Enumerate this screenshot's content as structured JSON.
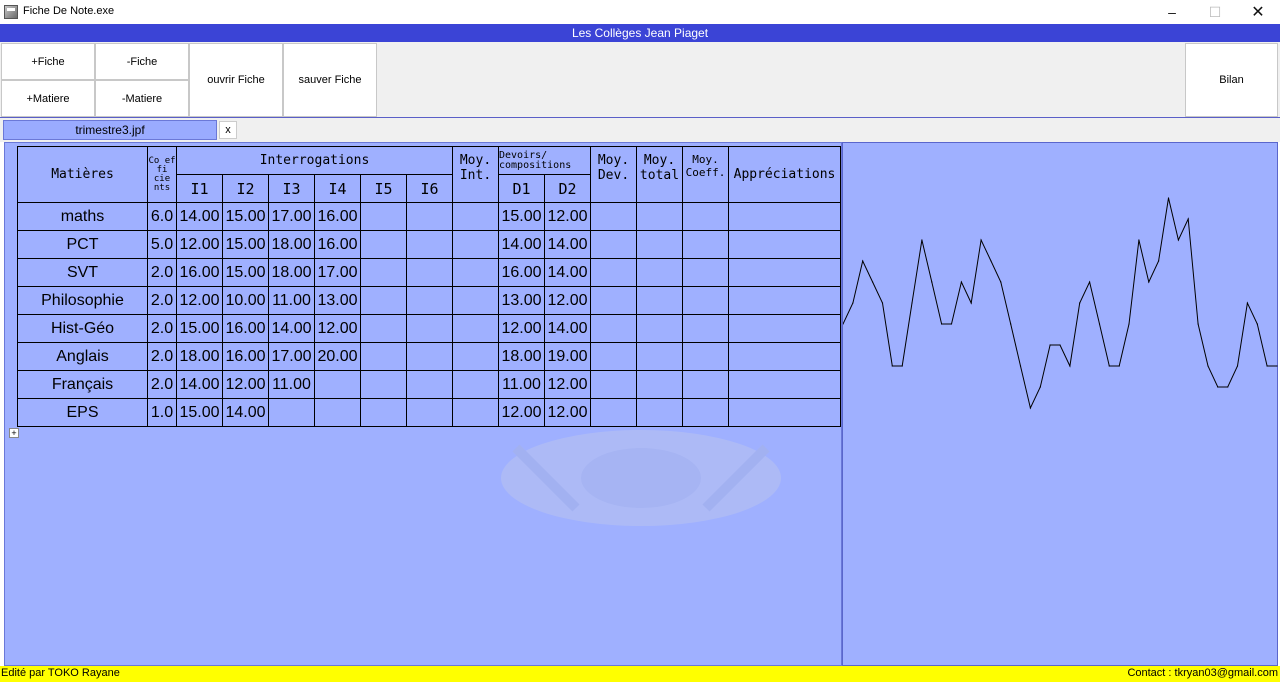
{
  "window": {
    "title": "Fiche De Note.exe",
    "minimize": "–",
    "maximize": "☐",
    "close": "✕"
  },
  "banner": "Les Collèges Jean Piaget",
  "toolbar": {
    "add_sheet": "+Fiche",
    "remove_sheet": "-Fiche",
    "add_subject": "+Matiere",
    "remove_subject": "-Matiere",
    "open_sheet": "ouvrir Fiche",
    "save_sheet": "sauver Fiche",
    "summary": "Bilan"
  },
  "tab": {
    "label": "trimestre3.jpf",
    "close": "x"
  },
  "table": {
    "headers": {
      "subject": "Matières",
      "coef": "Co ef fi cie nts",
      "interrogations": "Interrogations",
      "interro_cols": [
        "I1",
        "I2",
        "I3",
        "I4",
        "I5",
        "I6"
      ],
      "moy_int": "Moy. Int.",
      "devoirs": "Devoirs/ compositions",
      "devoir_cols": [
        "D1",
        "D2"
      ],
      "moy_dev": "Moy. Dev.",
      "moy_total": "Moy. total",
      "moy_coeff": "Moy. Coeff.",
      "appreciations": "Appréciations"
    },
    "rows": [
      {
        "subject": "maths",
        "coef": "6.0",
        "i": [
          "14.00",
          "15.00",
          "17.00",
          "16.00",
          "",
          ""
        ],
        "moy_int": "",
        "d": [
          "15.00",
          "12.00"
        ],
        "moy_dev": "",
        "moy_total": "",
        "moy_coeff": "",
        "appreciation": ""
      },
      {
        "subject": "PCT",
        "coef": "5.0",
        "i": [
          "12.00",
          "15.00",
          "18.00",
          "16.00",
          "",
          ""
        ],
        "moy_int": "",
        "d": [
          "14.00",
          "14.00"
        ],
        "moy_dev": "",
        "moy_total": "",
        "moy_coeff": "",
        "appreciation": ""
      },
      {
        "subject": "SVT",
        "coef": "2.0",
        "i": [
          "16.00",
          "15.00",
          "18.00",
          "17.00",
          "",
          ""
        ],
        "moy_int": "",
        "d": [
          "16.00",
          "14.00"
        ],
        "moy_dev": "",
        "moy_total": "",
        "moy_coeff": "",
        "appreciation": ""
      },
      {
        "subject": "Philosophie",
        "coef": "2.0",
        "i": [
          "12.00",
          "10.00",
          "11.00",
          "13.00",
          "",
          ""
        ],
        "moy_int": "",
        "d": [
          "13.00",
          "12.00"
        ],
        "moy_dev": "",
        "moy_total": "",
        "moy_coeff": "",
        "appreciation": ""
      },
      {
        "subject": "Hist-Géo",
        "coef": "2.0",
        "i": [
          "15.00",
          "16.00",
          "14.00",
          "12.00",
          "",
          ""
        ],
        "moy_int": "",
        "d": [
          "12.00",
          "14.00"
        ],
        "moy_dev": "",
        "moy_total": "",
        "moy_coeff": "",
        "appreciation": ""
      },
      {
        "subject": "Anglais",
        "coef": "2.0",
        "i": [
          "18.00",
          "16.00",
          "17.00",
          "20.00",
          "",
          ""
        ],
        "moy_int": "",
        "d": [
          "18.00",
          "19.00"
        ],
        "moy_dev": "",
        "moy_total": "",
        "moy_coeff": "",
        "appreciation": ""
      },
      {
        "subject": "Français",
        "coef": "2.0",
        "i": [
          "14.00",
          "12.00",
          "11.00",
          "",
          "",
          ""
        ],
        "moy_int": "",
        "d": [
          "11.00",
          "12.00"
        ],
        "moy_dev": "",
        "moy_total": "",
        "moy_coeff": "",
        "appreciation": ""
      },
      {
        "subject": "EPS",
        "coef": "1.0",
        "i": [
          "15.00",
          "14.00",
          "",
          "",
          "",
          ""
        ],
        "moy_int": "",
        "d": [
          "12.00",
          "12.00"
        ],
        "moy_dev": "",
        "moy_total": "",
        "moy_coeff": "",
        "appreciation": ""
      }
    ],
    "add_row": "+"
  },
  "chart_data": {
    "type": "line",
    "series": [
      {
        "values": [
          14,
          15,
          17,
          16,
          15,
          12,
          12,
          15,
          18,
          16,
          14,
          14,
          16,
          15,
          18,
          17,
          16,
          14,
          12,
          10,
          11,
          13,
          13,
          12,
          15,
          16,
          14,
          12,
          12,
          14,
          18,
          16,
          17,
          20,
          18,
          19,
          14,
          12,
          11,
          11,
          12,
          15,
          14,
          12,
          12
        ]
      }
    ],
    "ylim": [
      0,
      20
    ],
    "grid": false,
    "stroke_color": "#000000"
  },
  "status": {
    "left": "Edité par TOKO Rayane",
    "right": "Contact : tkryan03@gmail.com"
  },
  "colors": {
    "banner": "#3b44d6",
    "panel": "#9fb0ff",
    "tab": "#9aabff",
    "status": "#ffff00"
  }
}
